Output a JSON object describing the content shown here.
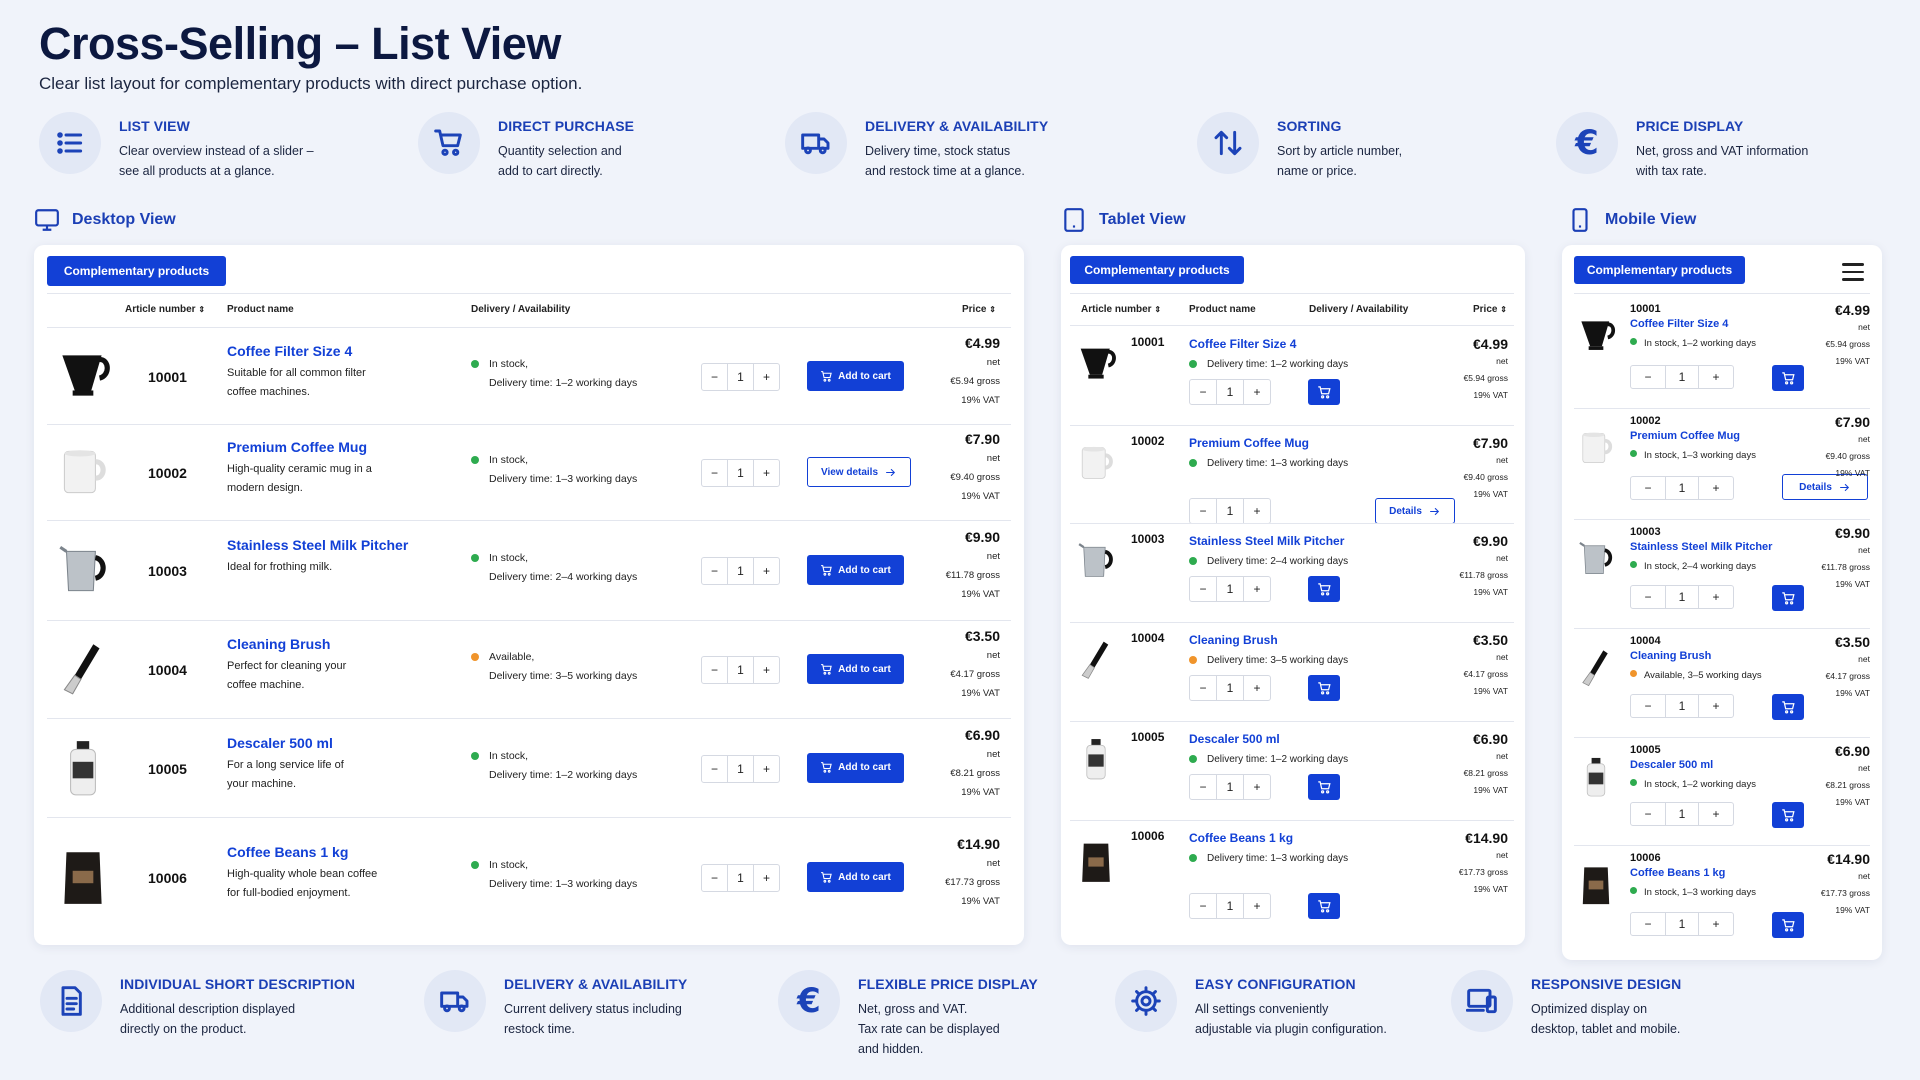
{
  "page": {
    "title": "Cross-Selling – List View",
    "subtitle": "Clear list layout for complementary products with direct purchase option."
  },
  "top_features": [
    {
      "icon": "list-icon",
      "title": "LIST VIEW",
      "desc": "Clear overview instead of a slider –\nsee all products at a glance."
    },
    {
      "icon": "cart-icon",
      "title": "DIRECT PURCHASE",
      "desc": "Quantity selection and\nadd to cart directly."
    },
    {
      "icon": "truck-icon",
      "title": "DELIVERY & AVAILABILITY",
      "desc": "Delivery time, stock status\nand restock time at a glance."
    },
    {
      "icon": "sort-icon",
      "title": "SORTING",
      "desc": "Sort by article number,\nname or price."
    },
    {
      "icon": "euro-icon",
      "title": "PRICE DISPLAY",
      "desc": "Net, gross and VAT information\nwith tax rate."
    }
  ],
  "views": {
    "desktop": "Desktop View",
    "tablet": "Tablet View",
    "mobile": "Mobile View"
  },
  "tab_label": "Complementary products",
  "columns": {
    "article": "Article number",
    "name": "Product name",
    "delivery": "Delivery / Availability",
    "price": "Price"
  },
  "buttons": {
    "add_to_cart": "Add to cart",
    "view_details": "View details",
    "details": "Details"
  },
  "products": [
    {
      "art": "10001",
      "name": "Coffee Filter Size 4",
      "d1": "Suitable for all common filter",
      "d2": "coffee machines.",
      "status": "In stock,",
      "status_color": "green",
      "delivery": "Delivery time: 1–2 working days",
      "m_avail": "In stock, 1–2 working days",
      "qty": "1",
      "price": "€4.99",
      "net": "net",
      "gross": "€5.94 gross",
      "vat": "19% VAT",
      "button": "cart"
    },
    {
      "art": "10002",
      "name": "Premium Coffee Mug",
      "d1": "High-quality ceramic mug in a",
      "d2": "modern design.",
      "status": "In stock,",
      "status_color": "green",
      "delivery": "Delivery time: 1–3 working days",
      "m_avail": "In stock, 1–3 working days",
      "qty": "1",
      "price": "€7.90",
      "net": "net",
      "gross": "€9.40 gross",
      "vat": "19% VAT",
      "button": "details"
    },
    {
      "art": "10003",
      "name": "Stainless Steel Milk Pitcher",
      "d1": "Ideal for frothing milk.",
      "d2": "",
      "status": "In stock,",
      "status_color": "green",
      "delivery": "Delivery time: 2–4 working days",
      "m_avail": "In stock, 2–4 working days",
      "qty": "1",
      "price": "€9.90",
      "net": "net",
      "gross": "€11.78 gross",
      "vat": "19% VAT",
      "button": "cart"
    },
    {
      "art": "10004",
      "name": "Cleaning Brush",
      "d1": "Perfect for cleaning your",
      "d2": "coffee machine.",
      "status": "Available,",
      "status_color": "orange",
      "delivery": "Delivery time: 3–5 working days",
      "m_avail": "Available, 3–5 working days",
      "qty": "1",
      "price": "€3.50",
      "net": "net",
      "gross": "€4.17 gross",
      "vat": "19% VAT",
      "button": "cart"
    },
    {
      "art": "10005",
      "name": "Descaler 500 ml",
      "d1": "For a long service life of",
      "d2": "your machine.",
      "status": "In stock,",
      "status_color": "green",
      "delivery": "Delivery time: 1–2 working days",
      "m_avail": "In stock, 1–2 working days",
      "qty": "1",
      "price": "€6.90",
      "net": "net",
      "gross": "€8.21 gross",
      "vat": "19% VAT",
      "button": "cart"
    },
    {
      "art": "10006",
      "name": "Coffee Beans 1 kg",
      "d1": "High-quality whole bean coffee",
      "d2": "for full-bodied enjoyment.",
      "status": "In stock,",
      "status_color": "green",
      "delivery": "Delivery time: 1–3 working days",
      "m_avail": "In stock, 1–3 working days",
      "qty": "1",
      "price": "€14.90",
      "net": "net",
      "gross": "€17.73 gross",
      "vat": "19% VAT",
      "button": "cart"
    }
  ],
  "bottom_features": [
    {
      "icon": "document-icon",
      "title": "INDIVIDUAL SHORT DESCRIPTION",
      "desc": "Additional description displayed\ndirectly on the product."
    },
    {
      "icon": "truck-icon",
      "title": "DELIVERY & AVAILABILITY",
      "desc": "Current delivery status including\nrestock time."
    },
    {
      "icon": "euro-icon",
      "title": "FLEXIBLE PRICE DISPLAY",
      "desc": "Net, gross and VAT.\nTax rate can be displayed\nand hidden."
    },
    {
      "icon": "gear-icon",
      "title": "EASY CONFIGURATION",
      "desc": "All settings conveniently\nadjustable via plugin configuration."
    },
    {
      "icon": "devices-icon",
      "title": "RESPONSIVE DESIGN",
      "desc": "Optimized display on\ndesktop, tablet and mobile."
    }
  ],
  "colors": {
    "accent": "#1240d6",
    "heading": "#1b3fb5",
    "in_stock": "#2eab4f",
    "available": "#f0942b",
    "background": "#f0f3fa"
  }
}
